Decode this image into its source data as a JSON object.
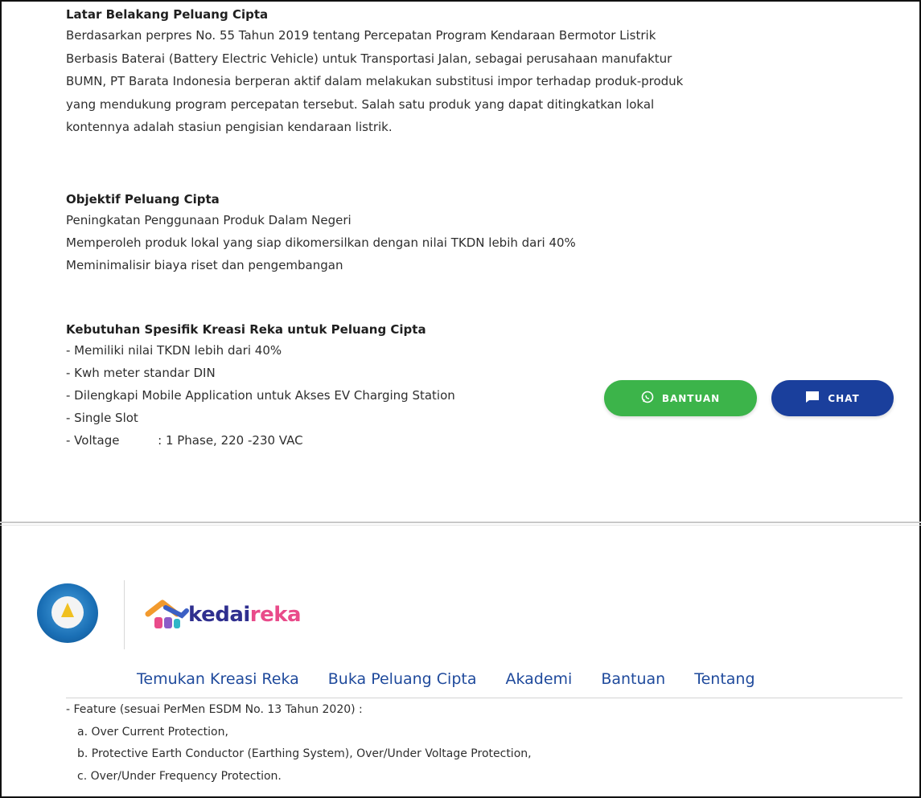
{
  "section1": {
    "title": "Latar Belakang Peluang Cipta",
    "lines": [
      "Berdasarkan perpres No. 55 Tahun 2019 tentang Percepatan Program Kendaraan Bermotor Listrik",
      "Berbasis Baterai (Battery Electric Vehicle) untuk Transportasi Jalan, sebagai perusahaan manufaktur",
      "BUMN, PT Barata Indonesia berperan aktif dalam melakukan substitusi impor terhadap produk-produk",
      "yang mendukung program percepatan tersebut. Salah satu produk yang dapat ditingkatkan lokal",
      "kontennya adalah stasiun pengisian kendaraan listrik."
    ]
  },
  "section2": {
    "title": "Objektif Peluang Cipta",
    "lines": [
      "Peningkatan Penggunaan Produk Dalam Negeri",
      "Memperoleh produk lokal yang siap dikomersilkan dengan nilai TKDN lebih dari 40%",
      "Meminimalisir biaya riset dan pengembangan"
    ]
  },
  "section3": {
    "title": "Kebutuhan Spesifik Kreasi Reka untuk Peluang Cipta",
    "lines": [
      "- Memiliki nilai TKDN lebih dari 40%",
      "- Kwh meter standar DIN",
      "- Dilengkapi Mobile Application untuk Akses EV Charging Station",
      "- Single Slot",
      "- Voltage          : 1 Phase, 220 -230 VAC"
    ]
  },
  "buttons": {
    "bantuan": "BANTUAN",
    "chat": "CHAT"
  },
  "footer": {
    "brand_part1": "kedai",
    "brand_part2": "reka",
    "nav": [
      "Temukan Kreasi Reka",
      "Buka Peluang Cipta",
      "Akademi",
      "Bantuan",
      "Tentang"
    ]
  },
  "features": {
    "header": "- Feature (sesuai PerMen ESDM No. 13 Tahun 2020) :",
    "items": [
      "a. Over Current Protection,",
      "b. Protective Earth Conductor (Earthing System), Over/Under Voltage Protection,",
      "c. Over/Under Frequency Protection."
    ]
  },
  "colors": {
    "bantuan_green": "#3cb44a",
    "chat_blue": "#1a3f9c",
    "nav_link": "#1f4a9c",
    "brand_navy": "#2f2f8f",
    "brand_pink": "#e94b8a"
  }
}
